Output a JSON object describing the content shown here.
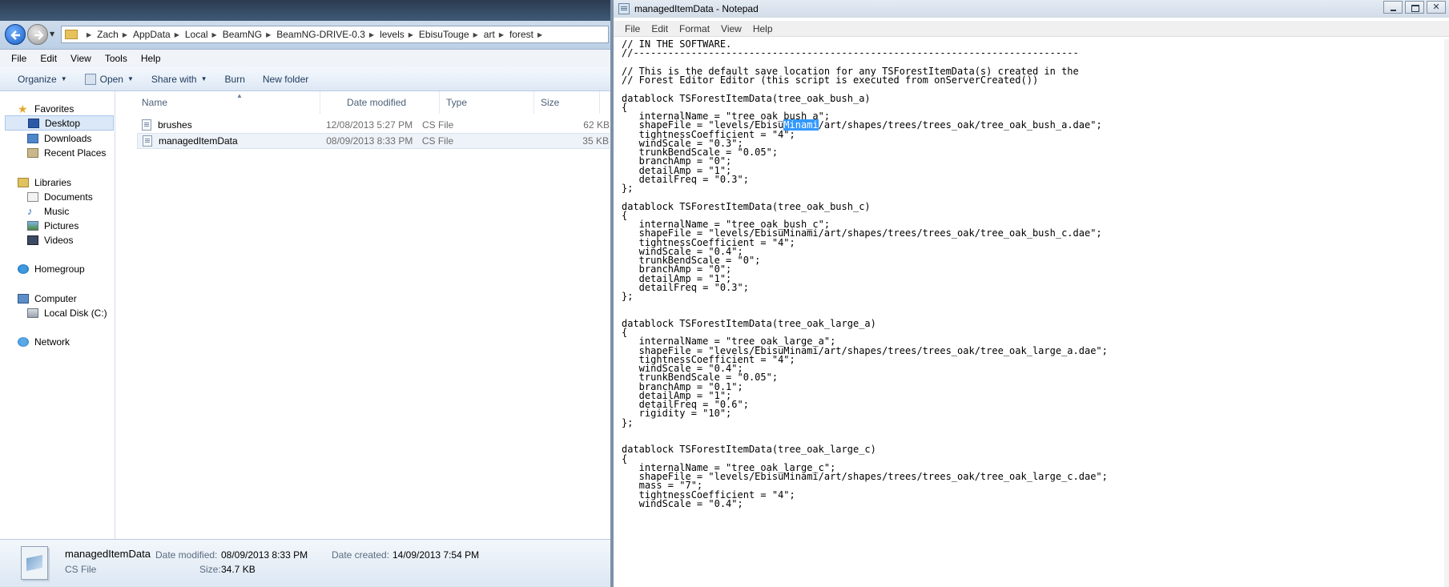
{
  "explorer": {
    "breadcrumb": [
      "Zach",
      "AppData",
      "Local",
      "BeamNG",
      "BeamNG-DRIVE-0.3",
      "levels",
      "EbisuTouge",
      "art",
      "forest"
    ],
    "menu": [
      "File",
      "Edit",
      "View",
      "Tools",
      "Help"
    ],
    "toolbar": {
      "organize": "Organize",
      "open": "Open",
      "share_with": "Share with",
      "burn": "Burn",
      "new_folder": "New folder"
    },
    "nav": {
      "favorites": "Favorites",
      "desktop": "Desktop",
      "downloads": "Downloads",
      "recent_places": "Recent Places",
      "libraries": "Libraries",
      "documents": "Documents",
      "music": "Music",
      "pictures": "Pictures",
      "videos": "Videos",
      "homegroup": "Homegroup",
      "computer": "Computer",
      "local_disk": "Local Disk (C:)",
      "network": "Network"
    },
    "columns": [
      "Name",
      "Date modified",
      "Type",
      "Size"
    ],
    "files": [
      {
        "name": "brushes",
        "date": "12/08/2013 5:27 PM",
        "type": "CS File",
        "size": "62 KB"
      },
      {
        "name": "managedItemData",
        "date": "08/09/2013 8:33 PM",
        "type": "CS File",
        "size": "35 KB"
      }
    ],
    "details": {
      "name": "managedItemData",
      "type": "CS File",
      "date_modified_label": "Date modified:",
      "date_modified": "08/09/2013 8:33 PM",
      "date_created_label": "Date created:",
      "date_created": "14/09/2013 7:54 PM",
      "size_label": "Size:",
      "size": "34.7 KB"
    }
  },
  "notepad": {
    "title": "managedItemData - Notepad",
    "menu": [
      "File",
      "Edit",
      "Format",
      "View",
      "Help"
    ],
    "lines": [
      "// IN THE SOFTWARE.",
      "//-----------------------------------------------------------------------------",
      "",
      "// This is the default save location for any TSForestItemData(s) created in the",
      "// Forest Editor Editor (this script is executed from onServerCreated())",
      "",
      "datablock TSForestItemData(tree_oak_bush_a)",
      "{",
      "   internalName = \"tree_oak_bush_a\";",
      "   shapeFile = \"levels/EbisuMinami/art/shapes/trees/trees_oak/tree_oak_bush_a.dae\";",
      "   tightnessCoefficient = \"4\";",
      "   windScale = \"0.3\";",
      "   trunkBendScale = \"0.05\";",
      "   branchAmp = \"0\";",
      "   detailAmp = \"1\";",
      "   detailFreq = \"0.3\";",
      "};",
      "",
      "datablock TSForestItemData(tree_oak_bush_c)",
      "{",
      "   internalName = \"tree_oak_bush_c\";",
      "   shapeFile = \"levels/EbisuMinami/art/shapes/trees/trees_oak/tree_oak_bush_c.dae\";",
      "   tightnessCoefficient = \"4\";",
      "   windScale = \"0.4\";",
      "   trunkBendScale = \"0\";",
      "   branchAmp = \"0\";",
      "   detailAmp = \"1\";",
      "   detailFreq = \"0.3\";",
      "};",
      "",
      "",
      "datablock TSForestItemData(tree_oak_large_a)",
      "{",
      "   internalName = \"tree_oak_large_a\";",
      "   shapeFile = \"levels/EbisuMinami/art/shapes/trees/trees_oak/tree_oak_large_a.dae\";",
      "   tightnessCoefficient = \"4\";",
      "   windScale = \"0.4\";",
      "   trunkBendScale = \"0.05\";",
      "   branchAmp = \"0.1\";",
      "   detailAmp = \"1\";",
      "   detailFreq = \"0.6\";",
      "   rigidity = \"10\";",
      "};",
      "",
      "",
      "datablock TSForestItemData(tree_oak_large_c)",
      "{",
      "   internalName = \"tree_oak_large_c\";",
      "   shapeFile = \"levels/EbisuMinami/art/shapes/trees/trees_oak/tree_oak_large_c.dae\";",
      "   mass = \"7\";",
      "   tightnessCoefficient = \"4\";",
      "   windScale = \"0.4\";"
    ],
    "selection": {
      "line": 9,
      "text": "Minami"
    }
  }
}
